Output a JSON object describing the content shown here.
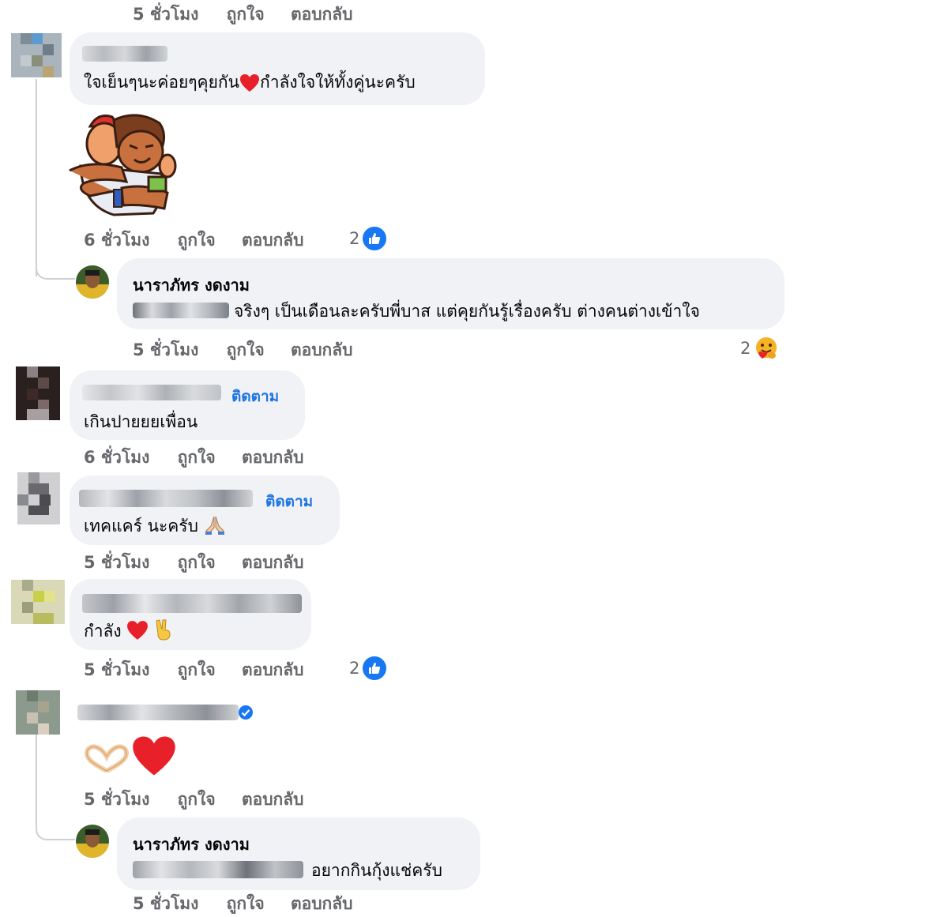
{
  "comments": [
    {
      "time": "5 ชั่วโมง",
      "like": "ถูกใจ",
      "reply": "ตอบกลับ"
    },
    {
      "text_a": "ใจเย็นๆนะค่อยๆคุยกัน",
      "text_b": "กำลังใจให้ทั้งคู่นะครับ",
      "time": "6 ชั่วโมง",
      "like": "ถูกใจ",
      "reply": "ตอบกลับ",
      "reaction_count": "2"
    },
    {
      "name": "นาราภัทร งดงาม",
      "text": "จริงๆ เป็นเดือนละครับพี่บาส แต่คุยกันรู้เรื่องครับ ต่างคนต่างเข้าใจ",
      "time": "5 ชั่วโมง",
      "like": "ถูกใจ",
      "reply": "ตอบกลับ",
      "reaction_count": "2"
    },
    {
      "follow": "ติดตาม",
      "text": "เกินปายยยเพื่อน",
      "time": "6 ชั่วโมง",
      "like": "ถูกใจ",
      "reply": "ตอบกลับ"
    },
    {
      "follow": "ติดตาม",
      "text": "เทคแคร์ นะครับ",
      "time": "5 ชั่วโมง",
      "like": "ถูกใจ",
      "reply": "ตอบกลับ"
    },
    {
      "text": "กำลัง",
      "time": "5 ชั่วโมง",
      "like": "ถูกใจ",
      "reply": "ตอบกลับ",
      "reaction_count": "2"
    },
    {
      "time": "5 ชั่วโมง",
      "like": "ถูกใจ",
      "reply": "ตอบกลับ"
    },
    {
      "name": "นาราภัทร งดงาม",
      "text": "อยากกินกุ้งแช่ครับ",
      "time": "5 ชั่วโมง",
      "like": "ถูกใจ",
      "reply": "ตอบกลับ"
    }
  ],
  "icons": {
    "heart": "heart-icon",
    "like": "like-thumb-icon",
    "care": "care-reaction-icon",
    "pray": "praying-hands-icon",
    "victory": "victory-hand-icon",
    "verified": "verified-badge-icon",
    "hand_heart": "hand-heart-icon"
  },
  "colors": {
    "bubble": "#f0f2f5",
    "meta": "#65676b",
    "link": "#1b74e4",
    "like_blue": "#1877f2",
    "heart_red": "#e8202a"
  }
}
